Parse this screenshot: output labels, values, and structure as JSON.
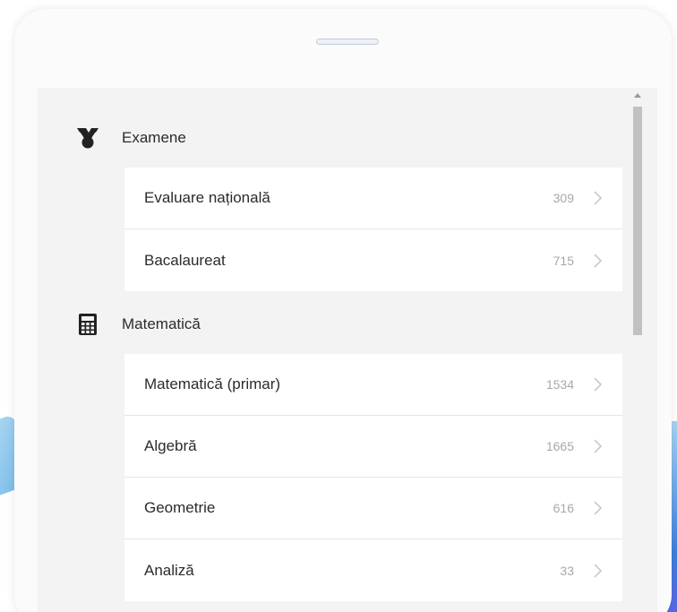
{
  "sheet": {
    "grabber_icon": "drag-handle-icon"
  },
  "sections": [
    {
      "title": "Examene",
      "icon": "medal-icon",
      "items": [
        {
          "label": "Evaluare națională",
          "count": "309"
        },
        {
          "label": "Bacalaureat",
          "count": "715"
        }
      ]
    },
    {
      "title": "Matematică",
      "icon": "calculator-icon",
      "items": [
        {
          "label": "Matematică (primar)",
          "count": "1534"
        },
        {
          "label": "Algebră",
          "count": "1665"
        },
        {
          "label": "Geometrie",
          "count": "616"
        },
        {
          "label": "Analiză",
          "count": "33"
        }
      ]
    }
  ],
  "colors": {
    "text": "#2b2b2b",
    "count": "#a8a8a8",
    "panel_bg": "#f3f3f3",
    "row_bg": "#ffffff",
    "icon": "#222222"
  }
}
